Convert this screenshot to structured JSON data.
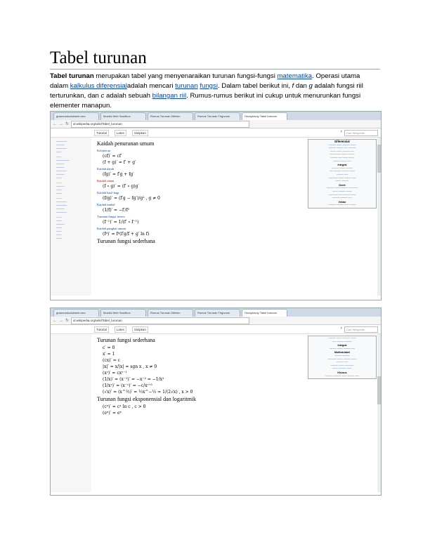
{
  "title": "Tabel turunan",
  "intro": {
    "p1_bold": "Tabel turunan",
    "p1_a": " merupakan tabel yang menyenaraikan turunan fungsi-fungsi ",
    "link_matematika": "matematika",
    "p1_b": ". Operasi utama dalam ",
    "link_kalkulus": "kalkulus diferensial",
    "p1_c": "adalah mencari ",
    "link_turunan": "turunan",
    "p1_d": " ",
    "link_fungsi": "fungsi",
    "p1_e": ". Dalam tabel berikut ini, ",
    "var_f": "f",
    "p1_f": " dan ",
    "var_g": "g",
    "p1_g": " adalah fungsi riil terturunkan, dan ",
    "var_c": "c",
    "p1_h": " adalah sebuah ",
    "link_bilangan": "bilangan riil",
    "p1_i": ". Rumus-rumus berikut ini cukup untuk menurunkan fungsi elementer manapun."
  },
  "screenshot1": {
    "tabs": [
      "guwezumudumavb.mro",
      "Mozilla Web Sandbox",
      "Rumus Turunan Diferen",
      "Rumus Turunan Trigonom",
      "Hocsplavny Tabel turunan"
    ],
    "url": "id.wikipedia.org/wiki/Tabel_turunan",
    "toolbar": [
      "Tutorial",
      "Latex",
      "Sisipkan"
    ],
    "search_placeholder": "Cari Wikipedia",
    "heading": "Kaidah penurunan umum",
    "subsections": [
      "Kelinieran",
      "Kaidah darab",
      "Kaidah rantai",
      "Kaidah hasil bagi",
      "Kaidah timbal",
      "Turunan fungsi invers",
      "Kaidah pangkat umum",
      "Turunan fungsi sederhana"
    ],
    "infobox_title": "Diferensial",
    "infobox_sections": [
      "Integral",
      "Deret",
      "Vektor"
    ]
  },
  "screenshot2": {
    "tabs": [
      "guwezumudumavb.mro",
      "Mozilla Web Sandbox",
      "Rumus Turunan Diferen",
      "Rumus Turunan Trigonom",
      "Hocsplavny Tabel turunan"
    ],
    "url": "id.wikipedia.org/wiki/Tabel_turunan",
    "toolbar": [
      "Tutorial",
      "Latex",
      "Sisipkan"
    ],
    "search_placeholder": "Cari Wikipedia",
    "heading": "Turunan fungsi sederhana",
    "heading2": "Turunan fungsi eksponensial dan logaritmik",
    "infobox_sections": [
      "Integral",
      "Multivariabel",
      "Khusus"
    ]
  }
}
